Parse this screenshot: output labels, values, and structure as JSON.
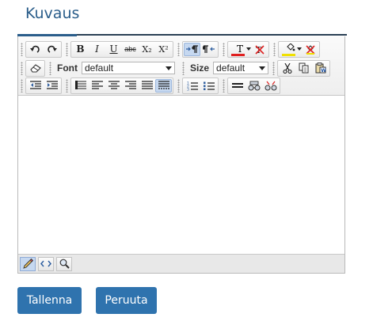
{
  "section": {
    "title": "Kuvaus"
  },
  "toolbar": {
    "row1": [
      "undo-icon",
      "redo-icon",
      "bold",
      "italic",
      "underline",
      "strikethrough",
      "subscript",
      "superscript",
      "ltr-icon",
      "rtl-icon",
      "text-color",
      "clear-text-color-icon",
      "highlight-color",
      "clear-highlight-icon"
    ],
    "bold": "B",
    "italic": "I",
    "underline": "U",
    "strike": "abc",
    "sub": "X₂",
    "sup": "X²",
    "text_color_glyph": "T",
    "text_color": "#e02020",
    "highlight_color": "#f0e000",
    "font_label": "Font",
    "font_value": "default",
    "size_label": "Size",
    "size_value": "default"
  },
  "statusbar": {
    "items": [
      "design-mode-icon",
      "html-mode-icon",
      "preview-icon"
    ]
  },
  "buttons": {
    "save": "Tallenna",
    "cancel": "Peruuta"
  },
  "colors": {
    "accent": "#2f73ae",
    "title": "#2a5d8a",
    "active_toggle": "#c6d8f0"
  }
}
